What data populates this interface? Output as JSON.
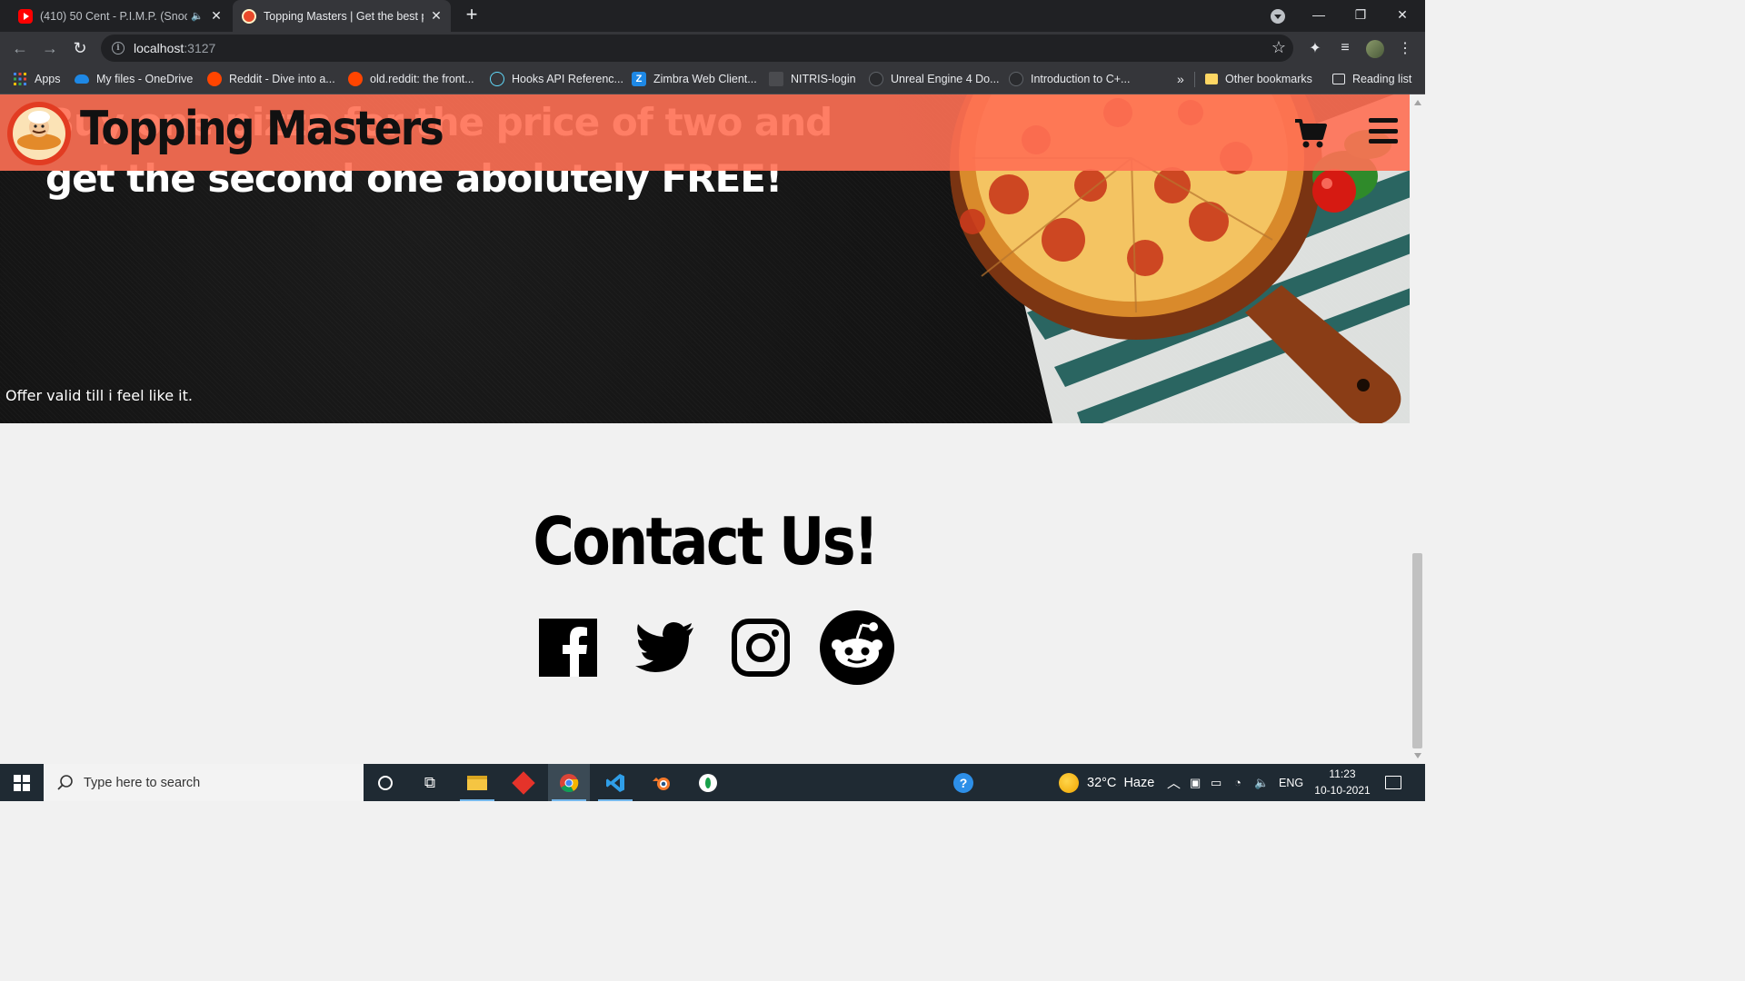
{
  "browser": {
    "tabs": [
      {
        "title": "(410) 50 Cent - P.I.M.P. (Snoo",
        "favicon": "youtube-icon",
        "audio": true
      },
      {
        "title": "Topping Masters | Get the best p",
        "favicon": "pizza-icon",
        "active": true
      }
    ],
    "address": {
      "host": "localhost",
      "port": ":3127"
    },
    "bookmarks": [
      {
        "label": "Apps",
        "icon": "apps-grid-icon"
      },
      {
        "label": "My files - OneDrive",
        "icon": "onedrive-icon"
      },
      {
        "label": "Reddit - Dive into a...",
        "icon": "reddit-icon"
      },
      {
        "label": "old.reddit: the front...",
        "icon": "reddit-icon"
      },
      {
        "label": "Hooks API Referenc...",
        "icon": "react-icon"
      },
      {
        "label": "Zimbra Web Client...",
        "icon": "zimbra-icon"
      },
      {
        "label": "NITRIS-login",
        "icon": "nitris-icon"
      },
      {
        "label": "Unreal Engine 4 Do...",
        "icon": "unreal-icon"
      },
      {
        "label": "Introduction to C+...",
        "icon": "unreal-icon"
      }
    ],
    "bookmarks_overflow": "»",
    "other_bookmarks": "Other bookmarks",
    "reading_list": "Reading list"
  },
  "site": {
    "brand": "Topping Masters",
    "hero_headline": "Buy one pizza for the price of two and get the second one abolutely FREE!",
    "hero_offer": "Offer valid till i feel like it.",
    "contact_title": "Contact Us!",
    "social": [
      "facebook-icon",
      "twitter-icon",
      "instagram-icon",
      "reddit-icon"
    ],
    "header_color": "#ff7054"
  },
  "taskbar": {
    "search_placeholder": "Type here to search",
    "weather": "32°C  Haze",
    "language": "ENG",
    "time": "11:23",
    "date": "10-10-2021"
  }
}
